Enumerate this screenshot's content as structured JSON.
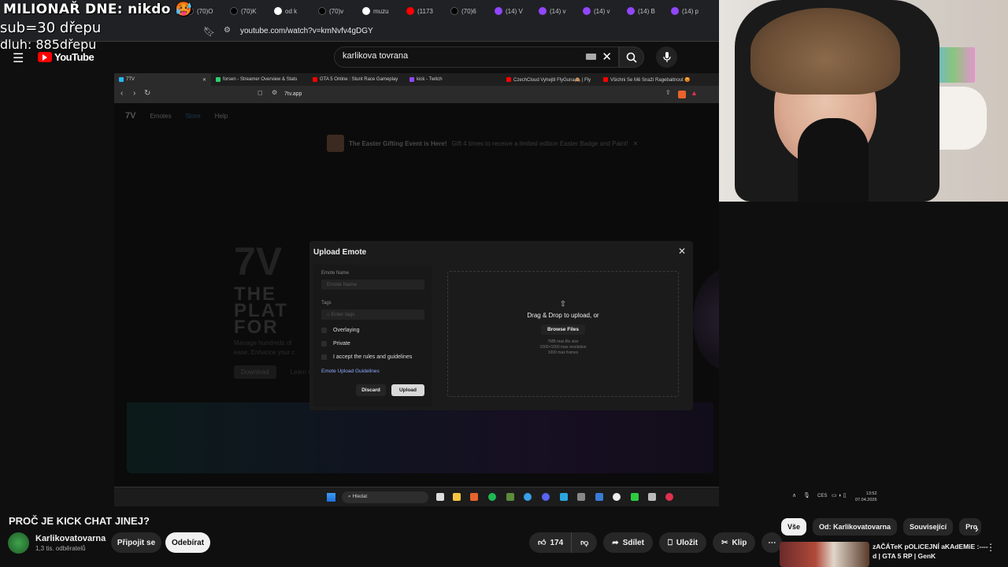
{
  "overlay": {
    "line1": "MILIONAŘ DNE: nikdo 🥵",
    "line2": "sub=30 dřepu",
    "line3": "dluh: 885dřepu"
  },
  "browser": {
    "tabs": [
      "(70)O",
      "(70)K",
      "od k",
      "(70)v",
      "muzu",
      "(1173",
      "(70)6",
      "(14) V",
      "(14) v",
      "(14) v",
      "(14) B",
      "(14) p"
    ],
    "url": "youtube.com/watch?v=kmNvfv4gDGY"
  },
  "youtube": {
    "logo": "YouTube",
    "search_value": "karlikova tovrana",
    "video_title": "PROČ JE KICK CHAT JINEJ?",
    "channel_name": "Karlikovatovarna",
    "channel_subs": "1,3 tis. odběratelů",
    "join_label": "Připojit se",
    "subscribe_label": "Odebírat",
    "likes": "174",
    "share_label": "Sdílet",
    "save_label": "Uložit",
    "clip_label": "Klip",
    "chips": [
      "Vše",
      "Od: Karlikovatovarna",
      "Související",
      "Pro"
    ],
    "rec_title": "zAČÁTeK pOLiCEJNÍ aKAdEMiE :----d | GTA 5 RP | GenK"
  },
  "inner": {
    "tabs": [
      "7TV",
      "forsen - Streamer Overview & Stats",
      "GTA 5 Online : Stunt Race Gameplay",
      "kick - Twitch",
      "CzechCloud Vyhejtil FlyGuna🙈 | Fly",
      "Všichni Se Mě Snaží Ragebaitnout 😡"
    ],
    "url": "7tv.app",
    "nav": [
      "Emotes",
      "Store",
      "Help"
    ],
    "banner_bold": "The Easter Gifting Event is Here!",
    "banner_text": "Gift 4 times to receive a limited edition Easter Badge and Paint!",
    "hero_big": "THE PLAT FOR",
    "hero_sub": "Manage hundreds of ease. Enhance your c",
    "download": "Download",
    "learn": "Learn more",
    "taskbar_search": "Hledat",
    "lang": "CES",
    "time": "13:52",
    "date": "07.04.2026"
  },
  "dialog": {
    "title": "Upload Emote",
    "name_label": "Emote Name",
    "name_placeholder": "Emote Name",
    "tags_label": "Tags",
    "tags_placeholder": "Enter tags",
    "cb_overlaying": "Overlaying",
    "cb_private": "Private",
    "cb_rules": "I accept the rules and guidelines",
    "guidelines_link": "Emote Upload Guidelines",
    "discard": "Discard",
    "upload": "Upload",
    "drop_text": "Drag & Drop to upload, or",
    "browse": "Browse Files",
    "limit1": "7MB max file size",
    "limit2": "1000×1000 max resolution",
    "limit3": "1000 max frames"
  },
  "colors": {
    "yt_red": "#ff0000",
    "link": "#8fa8ff",
    "accent_blue": "#3ea6ff"
  }
}
